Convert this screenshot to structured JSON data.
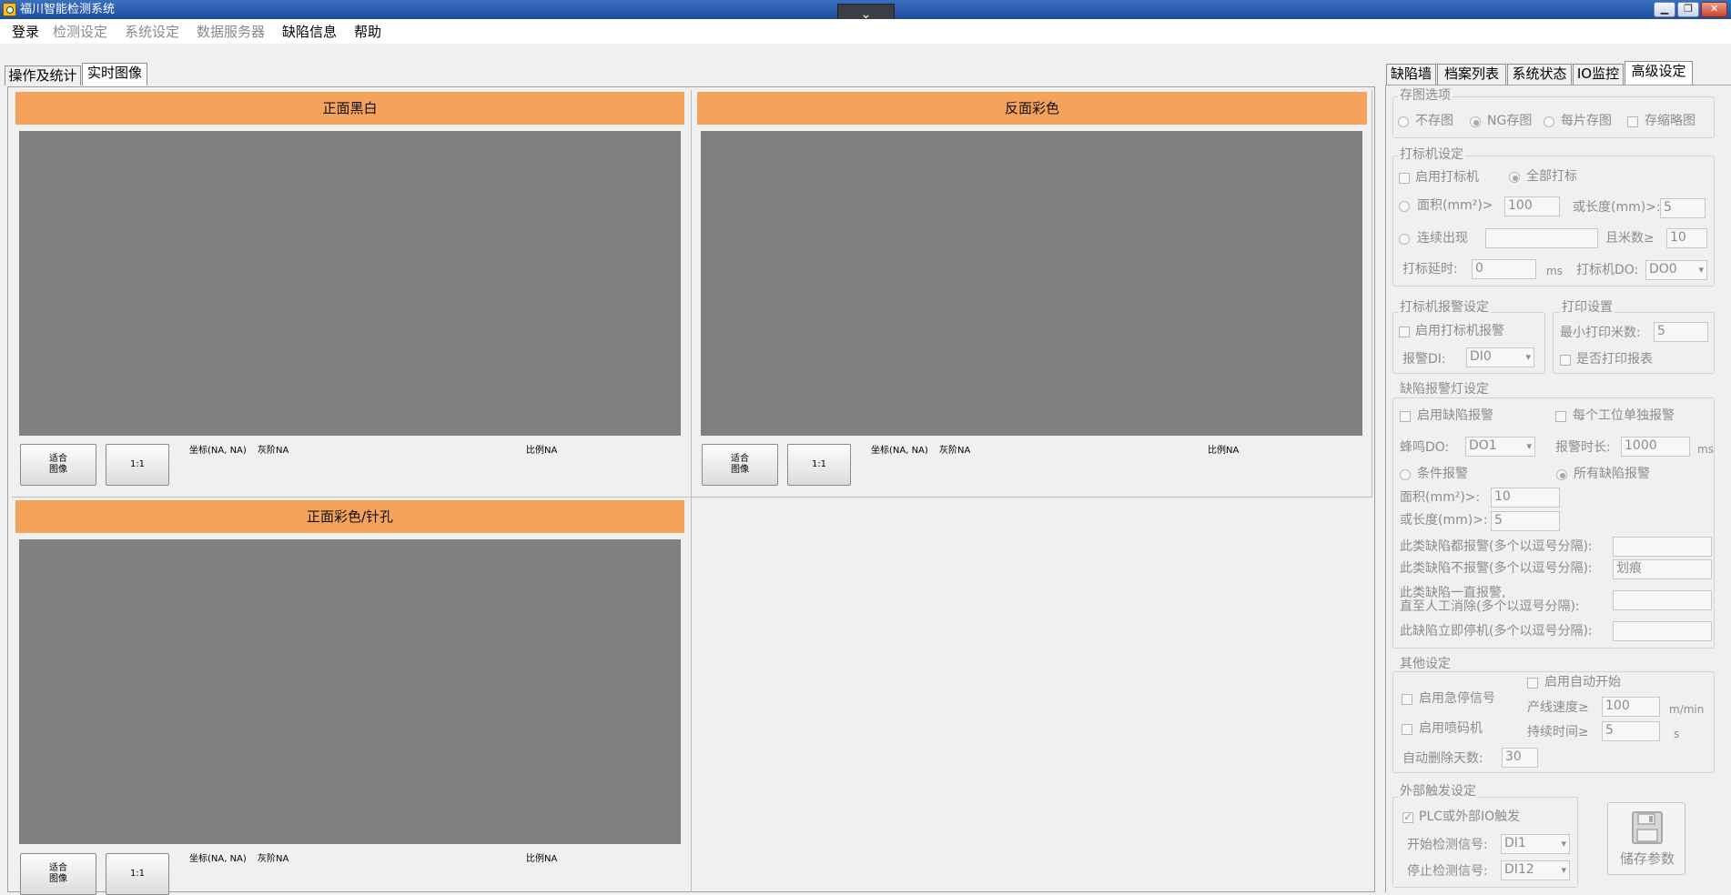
{
  "window": {
    "title": "福川智能检测系统",
    "collapse": "⌄",
    "min": "▁",
    "max": "❐",
    "close": "✕"
  },
  "menu": {
    "items": [
      "登录",
      "检测设定",
      "系统设定",
      "数据服务器",
      "缺陷信息",
      "帮助"
    ]
  },
  "left_tabs": [
    "操作及统计",
    "实时图像"
  ],
  "panels": [
    {
      "title": "正面黑白",
      "fit": "适合图像",
      "ratio_btn": "1:1",
      "coords": "坐标(NA, NA)",
      "gray": "灰阶NA",
      "scale": "比例NA"
    },
    {
      "title": "反面彩色",
      "fit": "适合图像",
      "ratio_btn": "1:1",
      "coords": "坐标(NA, NA)",
      "gray": "灰阶NA",
      "scale": "比例NA"
    },
    {
      "title": "正面彩色/针孔",
      "fit": "适合图像",
      "ratio_btn": "1:1",
      "coords": "坐标(NA, NA)",
      "gray": "灰阶NA",
      "scale": "比例NA"
    }
  ],
  "right_tabs": [
    "缺陷墙",
    "档案列表",
    "系统状态",
    "IO监控",
    "高级设定"
  ],
  "save_image": {
    "title": "存图选项",
    "opts": [
      "不存图",
      "NG存图",
      "每片存图"
    ],
    "thumb": "存缩略图"
  },
  "marker": {
    "title": "打标机设定",
    "enable": "启用打标机",
    "all": "全部打标",
    "area_lbl": "面积(mm²)>",
    "area": "100",
    "or_len_lbl": "或长度(mm)>:",
    "or_len": "5",
    "cont_lbl": "连续出现",
    "cont": "",
    "meter_lbl": "且米数≥",
    "meter": "10",
    "delay_lbl": "打标延时:",
    "delay": "0",
    "ms": "ms",
    "do_lbl": "打标机DO:",
    "do": "DO0"
  },
  "marker_alarm": {
    "title": "打标机报警设定",
    "enable": "启用打标机报警",
    "di_lbl": "报警DI:",
    "di": "DI0"
  },
  "print": {
    "title": "打印设置",
    "min_lbl": "最小打印米数:",
    "min": "5",
    "report": "是否打印报表"
  },
  "defect_alarm": {
    "title": "缺陷报警灯设定",
    "enable": "启用缺陷报警",
    "per_station": "每个工位单独报警",
    "buzz_lbl": "蜂鸣DO:",
    "buzz": "DO1",
    "dur_lbl": "报警时长:",
    "dur": "1000",
    "ms": "ms",
    "cond": "条件报警",
    "all": "所有缺陷报警",
    "area_lbl": "面积(mm²)>:",
    "area": "10",
    "len_lbl": "或长度(mm)>:",
    "len": "5",
    "alarm_lbl": "此类缺陷都报警(多个以逗号分隔):",
    "alarm": "",
    "noalarm_lbl": "此类缺陷不报警(多个以逗号分隔):",
    "noalarm": "划痕",
    "keep_lbl1": "此类缺陷一直报警,",
    "keep_lbl2": "直至人工消除(多个以逗号分隔):",
    "keep": "",
    "stop_lbl": "此缺陷立即停机(多个以逗号分隔):",
    "stop": ""
  },
  "other": {
    "title": "其他设定",
    "estop": "启用急停信号",
    "autostart": "启用自动开始",
    "speed_lbl": "产线速度≥",
    "speed": "100",
    "speed_unit": "m/min",
    "inkjet": "启用喷码机",
    "hold_lbl": "持续时间≥",
    "hold": "5",
    "hold_unit": "s",
    "autodel_lbl": "自动删除天数:",
    "autodel": "30"
  },
  "trigger": {
    "title": "外部触发设定",
    "plc": "PLC或外部IO触发",
    "start_lbl": "开始检测信号:",
    "start": "DI1",
    "stop_lbl": "停止检测信号:",
    "stop": "DI12"
  },
  "save_btn": "储存参数"
}
